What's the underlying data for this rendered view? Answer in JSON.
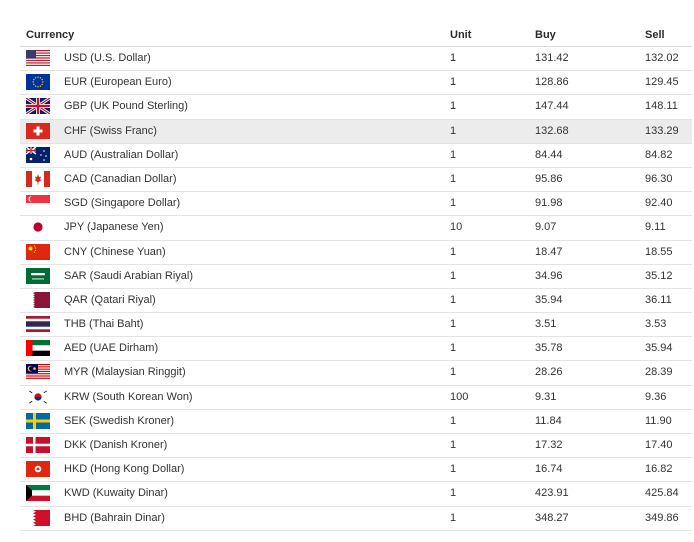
{
  "headers": {
    "currency": "Currency",
    "unit": "Unit",
    "buy": "Buy",
    "sell": "Sell"
  },
  "highlight_color": "#ececec",
  "rows": [
    {
      "code": "USD (U.S. Dollar)",
      "unit": "1",
      "buy": "131.42",
      "sell": "132.02",
      "flag": "us-flag-icon"
    },
    {
      "code": "EUR (European Euro)",
      "unit": "1",
      "buy": "128.86",
      "sell": "129.45",
      "flag": "eu-flag-icon"
    },
    {
      "code": "GBP (UK Pound Sterling)",
      "unit": "1",
      "buy": "147.44",
      "sell": "148.11",
      "flag": "uk-flag-icon"
    },
    {
      "code": "CHF (Swiss Franc)",
      "unit": "1",
      "buy": "132.68",
      "sell": "133.29",
      "flag": "ch-flag-icon",
      "highlighted": true
    },
    {
      "code": "AUD (Australian Dollar)",
      "unit": "1",
      "buy": "84.44",
      "sell": "84.82",
      "flag": "au-flag-icon"
    },
    {
      "code": "CAD (Canadian Dollar)",
      "unit": "1",
      "buy": "95.86",
      "sell": "96.30",
      "flag": "ca-flag-icon"
    },
    {
      "code": "SGD (Singapore Dollar)",
      "unit": "1",
      "buy": "91.98",
      "sell": "92.40",
      "flag": "sg-flag-icon"
    },
    {
      "code": "JPY (Japanese Yen)",
      "unit": "10",
      "buy": "9.07",
      "sell": "9.11",
      "flag": "jp-flag-icon"
    },
    {
      "code": "CNY (Chinese Yuan)",
      "unit": "1",
      "buy": "18.47",
      "sell": "18.55",
      "flag": "cn-flag-icon"
    },
    {
      "code": "SAR (Saudi Arabian Riyal)",
      "unit": "1",
      "buy": "34.96",
      "sell": "35.12",
      "flag": "sa-flag-icon"
    },
    {
      "code": "QAR (Qatari Riyal)",
      "unit": "1",
      "buy": "35.94",
      "sell": "36.11",
      "flag": "qa-flag-icon"
    },
    {
      "code": "THB (Thai Baht)",
      "unit": "1",
      "buy": "3.51",
      "sell": "3.53",
      "flag": "th-flag-icon"
    },
    {
      "code": "AED (UAE Dirham)",
      "unit": "1",
      "buy": "35.78",
      "sell": "35.94",
      "flag": "ae-flag-icon"
    },
    {
      "code": "MYR (Malaysian Ringgit)",
      "unit": "1",
      "buy": "28.26",
      "sell": "28.39",
      "flag": "my-flag-icon"
    },
    {
      "code": "KRW (South Korean Won)",
      "unit": "100",
      "buy": "9.31",
      "sell": "9.36",
      "flag": "kr-flag-icon"
    },
    {
      "code": "SEK (Swedish Kroner)",
      "unit": "1",
      "buy": "11.84",
      "sell": "11.90",
      "flag": "se-flag-icon"
    },
    {
      "code": "DKK (Danish Kroner)",
      "unit": "1",
      "buy": "17.32",
      "sell": "17.40",
      "flag": "dk-flag-icon"
    },
    {
      "code": "HKD (Hong Kong Dollar)",
      "unit": "1",
      "buy": "16.74",
      "sell": "16.82",
      "flag": "hk-flag-icon"
    },
    {
      "code": "KWD (Kuwaity Dinar)",
      "unit": "1",
      "buy": "423.91",
      "sell": "425.84",
      "flag": "kw-flag-icon"
    },
    {
      "code": "BHD (Bahrain Dinar)",
      "unit": "1",
      "buy": "348.27",
      "sell": "349.86",
      "flag": "bh-flag-icon"
    }
  ]
}
